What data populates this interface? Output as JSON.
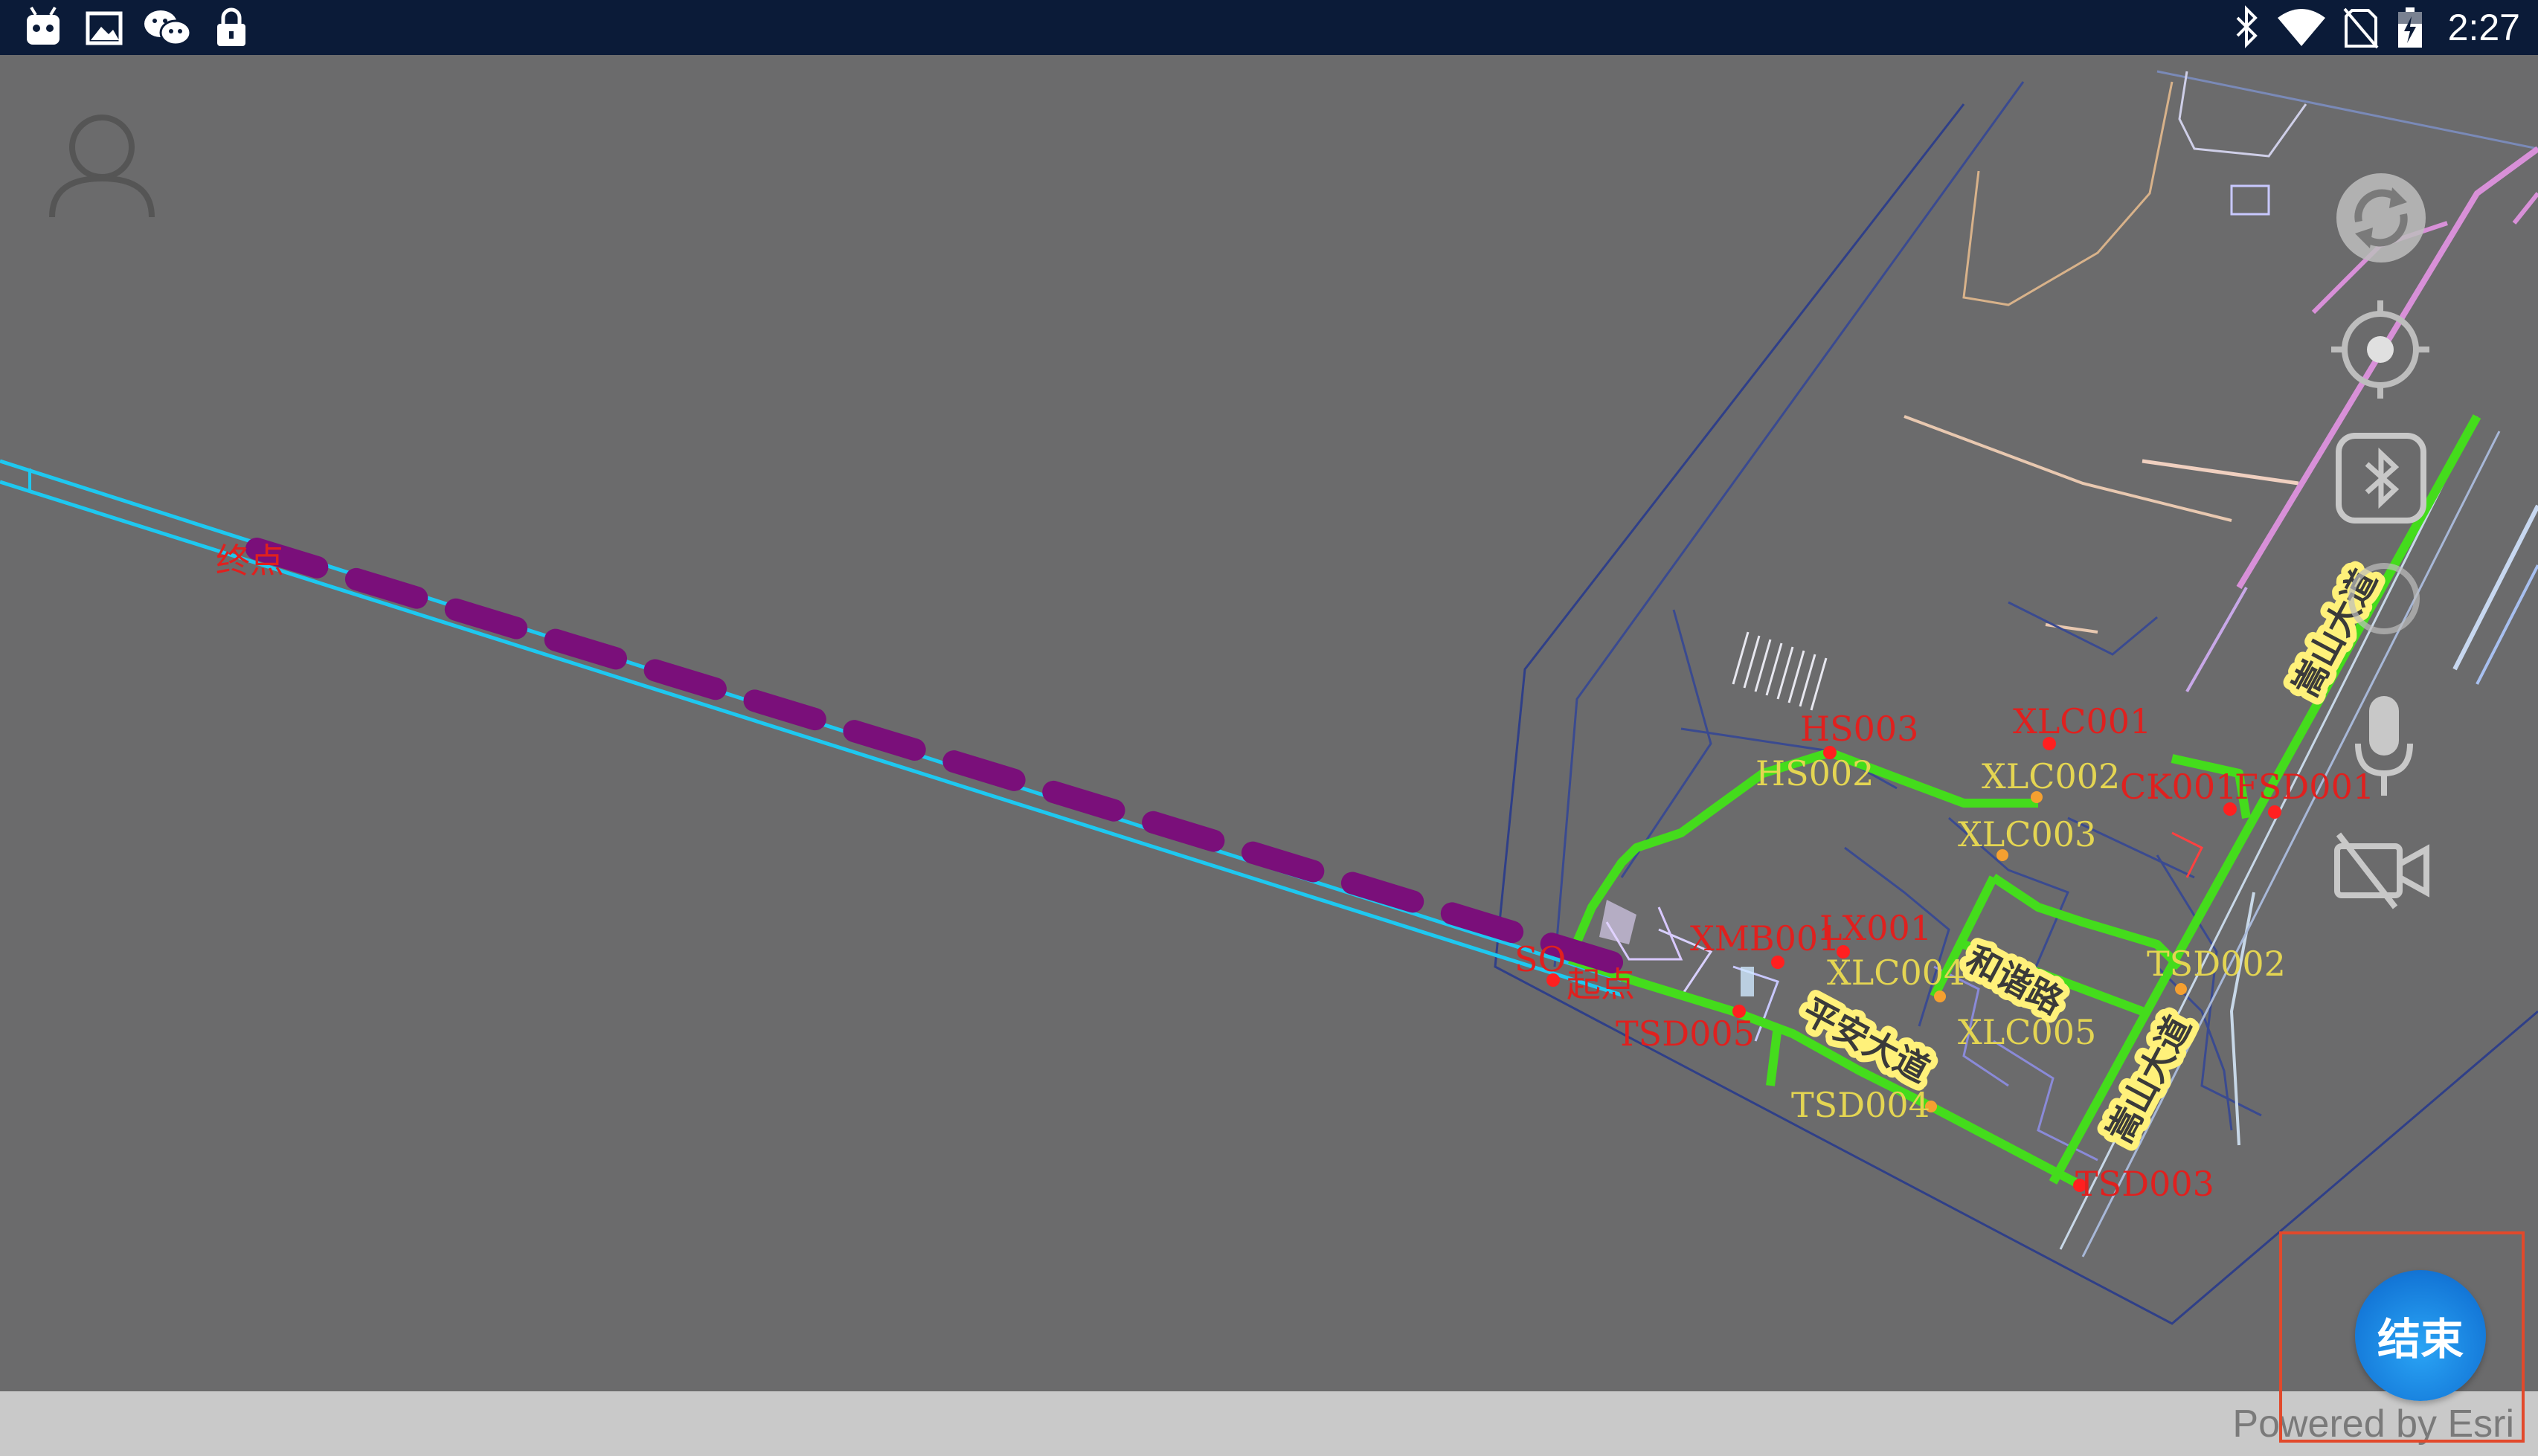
{
  "status_bar": {
    "time": "2:27",
    "left_icons": [
      "android-icon",
      "image-icon",
      "wechat-icon",
      "lock-icon"
    ],
    "right_icons": [
      "bluetooth-icon",
      "wifi-icon",
      "no-sim-icon",
      "battery-charging-icon"
    ]
  },
  "map": {
    "start_label": "起点",
    "end_label": "终点",
    "start_code": "SO",
    "red_labels": [
      "HS003",
      "XLC001",
      "CK001",
      "FSD001",
      "XMB001",
      "LX001",
      "TSD005",
      "TSD003"
    ],
    "yellow_labels": [
      "HS002",
      "XLC002",
      "XLC003",
      "XLC004",
      "XLC005",
      "TSD002",
      "TSD004"
    ],
    "road_names": [
      "和谐路",
      "平安大道",
      "嵩山大道",
      "嵩山大道"
    ],
    "colors": {
      "background": "#6b6b6c",
      "route_dash": "#7a0f7a",
      "pipeline": "#1ec8f0",
      "roads_green": "#44dc1c",
      "label_red": "#e0201e",
      "label_yellow": "#e4d552"
    }
  },
  "controls": {
    "user_icon": "user-icon",
    "refresh_icon": "refresh-icon",
    "locate_icon": "locate-icon",
    "bluetooth_icon": "bluetooth-icon",
    "mic_icon": "microphone-icon",
    "video_off_icon": "video-off-icon"
  },
  "end_button": {
    "label": "结束"
  },
  "attribution": "Powered by Esri"
}
